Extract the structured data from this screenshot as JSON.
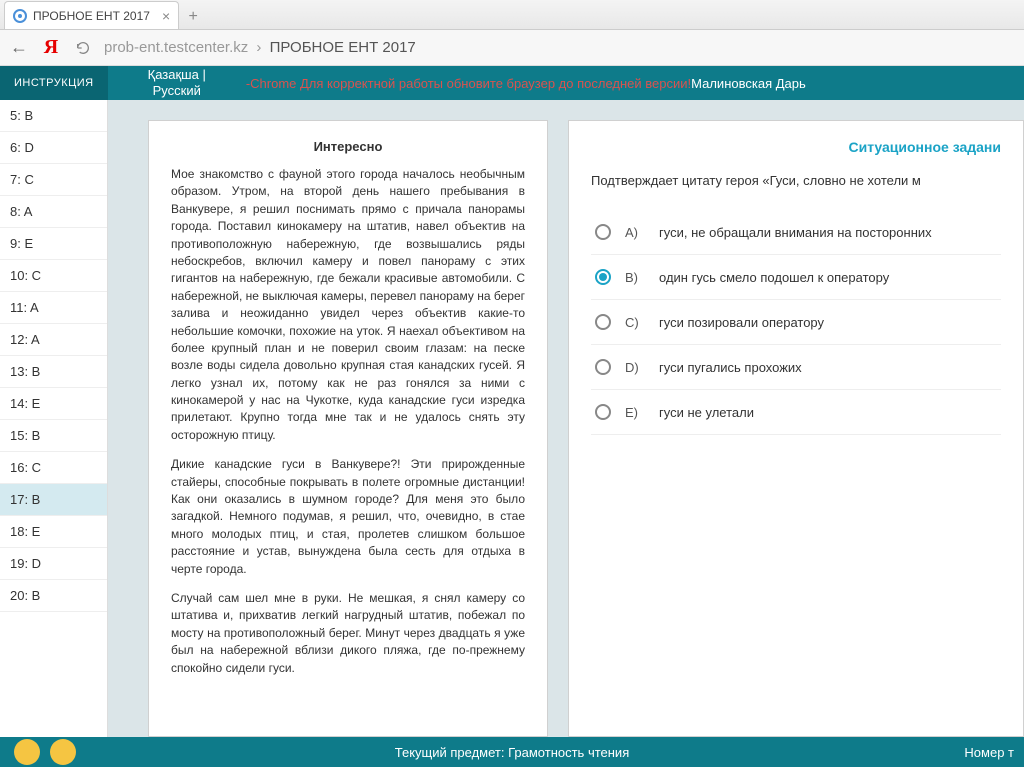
{
  "browser": {
    "tab_title": "ПРОБНОЕ ЕНТ 2017",
    "url_host": "prob-ent.testcenter.kz",
    "url_title": "ПРОБНОЕ ЕНТ 2017"
  },
  "header": {
    "instr": "ИНСТРУКЦИЯ",
    "lang1": "Қазақша |",
    "lang2": "Русский",
    "warn": "-Chrome Для корректной работы обновите браузер до последней версии!",
    "user": "Малиновская Дарь"
  },
  "answers": [
    {
      "label": "5: B"
    },
    {
      "label": "6: D"
    },
    {
      "label": "7: C"
    },
    {
      "label": "8: A"
    },
    {
      "label": "9: E"
    },
    {
      "label": "10: C"
    },
    {
      "label": "11: A"
    },
    {
      "label": "12: A"
    },
    {
      "label": "13: B"
    },
    {
      "label": "14: E"
    },
    {
      "label": "15: B"
    },
    {
      "label": "16: C"
    },
    {
      "label": "17: B",
      "sel": true
    },
    {
      "label": "18: E"
    },
    {
      "label": "19: D"
    },
    {
      "label": "20: B"
    }
  ],
  "passage": {
    "title": "Интересно",
    "p1": "Мое знакомство с фауной этого города началось необычным образом. Утром, на второй день нашего пребывания в Ванкувере, я решил поснимать прямо с причала панорамы города. Поставил кинокамеру на штатив, навел объектив на противоположную набережную, где возвышались ряды небоскребов, включил камеру и повел панораму с этих гигантов на набережную, где бежали красивые автомобили. С набережной, не выключая камеры, перевел панораму на берег залива и неожиданно увидел через объектив какие-то небольшие комочки, похожие на уток. Я наехал объективом на более крупный план и не поверил своим глазам: на песке возле воды сидела довольно крупная стая канадских гусей. Я легко узнал их, потому как не раз гонялся за ними с кинокамерой у нас на Чукотке, куда канадские гуси изредка прилетают. Крупно тогда мне так и не удалось снять эту осторожную птицу.",
    "p2": "Дикие канадские гуси в Ванкувере?! Эти прирожденные стайеры, способные покрывать в полете огромные дистанции! Как они оказались в шумном городе? Для меня это было загадкой. Немного подумав, я решил, что, очевидно, в стае много молодых птиц, и стая, пролетев слишком большое расстояние и устав, вынуждена была сесть для отдыха в черте города.",
    "p3": "Случай сам шел мне в руки. Не мешкая, я снял камеру со штатива и, прихватив легкий нагрудный штатив, побежал по мосту на противоположный берег. Минут через двадцать я уже был на набережной вблизи дикого пляжа, где по-прежнему спокойно сидели гуси."
  },
  "question": {
    "head": "Ситуационное задани",
    "text": "Подтверждает цитату героя  «Гуси, словно не хотели м",
    "options": [
      {
        "letter": "A)",
        "text": "гуси, не обращали внимания на посторонних"
      },
      {
        "letter": "B)",
        "text": "один гусь смело подошел к оператору",
        "checked": true
      },
      {
        "letter": "C)",
        "text": "гуси позировали оператору"
      },
      {
        "letter": "D)",
        "text": "гуси пугались прохожих"
      },
      {
        "letter": "E)",
        "text": "гуси не улетали"
      }
    ]
  },
  "footer": {
    "subject": "Текущий предмет: Грамотность чтения",
    "right": "Номер т"
  }
}
